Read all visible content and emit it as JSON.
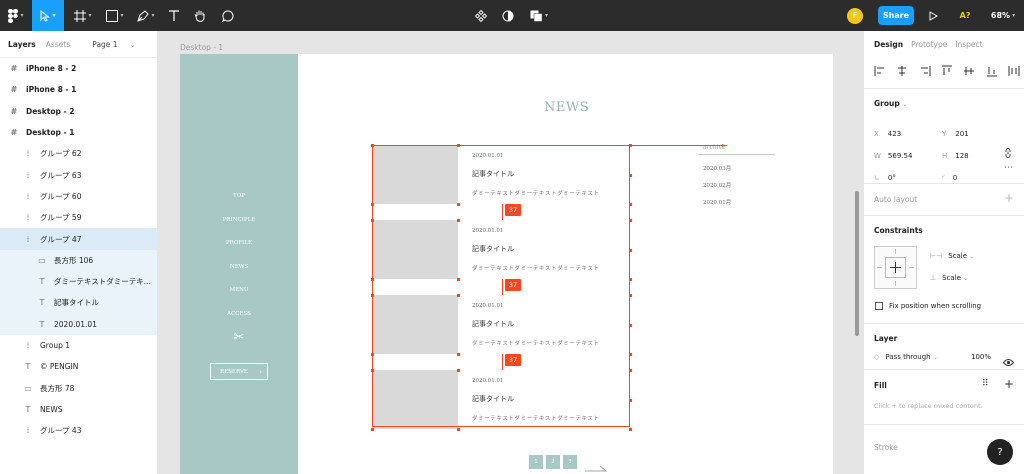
{
  "toolbar": {
    "share_label": "Share",
    "missing_fonts": "A?",
    "zoom": "68%",
    "avatar_initial": "F"
  },
  "layers_panel": {
    "tab_layers": "Layers",
    "tab_assets": "Assets",
    "page": "Page 1",
    "items": [
      {
        "label": "iPhone 8 - 2",
        "icon": "frame-icon"
      },
      {
        "label": "iPhone 8 - 1",
        "icon": "frame-icon"
      },
      {
        "label": "Desktop - 2",
        "icon": "frame-icon"
      },
      {
        "label": "Desktop - 1",
        "icon": "frame-icon"
      },
      {
        "label": "グループ 62",
        "icon": "group-icon"
      },
      {
        "label": "グループ 63",
        "icon": "group-icon"
      },
      {
        "label": "グループ 60",
        "icon": "group-icon"
      },
      {
        "label": "グループ 59",
        "icon": "group-icon"
      },
      {
        "label": "グループ 47",
        "icon": "group-icon"
      },
      {
        "label": "長方形 106",
        "icon": "rectangle-icon"
      },
      {
        "label": "ダミーテキストダミーテキ...",
        "icon": "text-icon"
      },
      {
        "label": "記事タイトル",
        "icon": "text-icon"
      },
      {
        "label": "2020.01.01",
        "icon": "text-icon"
      },
      {
        "label": "Group 1",
        "icon": "group-icon"
      },
      {
        "label": "© PENGIN",
        "icon": "text-icon"
      },
      {
        "label": "長方形 78",
        "icon": "rectangle-icon"
      },
      {
        "label": "NEWS",
        "icon": "text-icon"
      },
      {
        "label": "グループ 43",
        "icon": "group-icon"
      }
    ]
  },
  "canvas": {
    "frame_label": "Desktop - 1",
    "nav": [
      "TOP",
      "PRINCIPLE",
      "PROFILE",
      "NEWS",
      "MENU",
      "ACCESS"
    ],
    "reserve": "RESERVE",
    "news_title": "NEWS",
    "articles": [
      {
        "date": "2020.01.01",
        "title": "記事タイトル",
        "text": "ダミーテキストダミーテキストダミーテキスト",
        "badge": "37"
      },
      {
        "date": "2020.01.01",
        "title": "記事タイトル",
        "text": "ダミーテキストダミーテキストダミーテキスト",
        "badge": "37"
      },
      {
        "date": "2020.01.01",
        "title": "記事タイトル",
        "text": "ダミーテキストダミーテキストダミーテキスト",
        "badge": "37"
      },
      {
        "date": "2020.01.01",
        "title": "記事タイトル",
        "text": "ダミーテキストダミーテキストダミーテキスト"
      }
    ],
    "archive_title": "archive",
    "archive_items": [
      "2020.03月",
      "2020.02月",
      "2020.01月"
    ],
    "pagination": [
      "1",
      "2",
      "3"
    ]
  },
  "design_panel": {
    "tab_design": "Design",
    "tab_prototype": "Prototype",
    "tab_inspect": "Inspect",
    "group_label": "Group",
    "x_label": "X",
    "x_value": "423",
    "y_label": "Y",
    "y_value": "201",
    "w_label": "W",
    "w_value": "569.54",
    "h_label": "H",
    "h_value": "128",
    "rotation": "0°",
    "radius": "0",
    "auto_layout": "Auto layout",
    "constraints": "Constraints",
    "scale1": "Scale",
    "scale2": "Scale",
    "fix_position": "Fix position when scrolling",
    "layer": "Layer",
    "pass_through": "Pass through",
    "opacity": "100%",
    "fill": "Fill",
    "fill_hint": "Click + to replace mixed content.",
    "stroke": "Stroke",
    "help": "?"
  },
  "colors": {
    "accent": "#18a0fb",
    "selection": "#f24822",
    "sidebar": "#a8c8c6",
    "badge": "#f24822"
  }
}
